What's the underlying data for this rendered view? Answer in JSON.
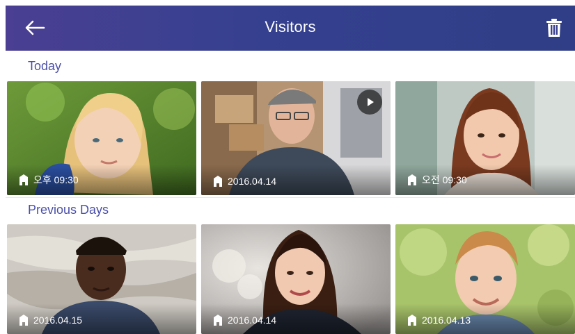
{
  "header": {
    "title": "Visitors",
    "back_icon": "arrow-left-icon",
    "delete_icon": "trash-icon",
    "bg_color": "#3a3f8f"
  },
  "sections": [
    {
      "label": "Today",
      "items": [
        {
          "date": "오후 09:30",
          "icon": "building-icon",
          "has_video": false
        },
        {
          "date": "2016.04.14",
          "icon": "building-icon",
          "has_video": true
        },
        {
          "date": "오전 09:30",
          "icon": "building-icon",
          "has_video": false
        }
      ]
    },
    {
      "label": "Previous Days",
      "items": [
        {
          "date": "2016.04.15",
          "icon": "building-icon",
          "has_video": false
        },
        {
          "date": "2016.04.14",
          "icon": "building-icon",
          "has_video": false
        },
        {
          "date": "2016.04.13",
          "icon": "building-icon",
          "has_video": false
        }
      ]
    }
  ],
  "colors": {
    "section_label": "#4a4fa8",
    "header_gradient_start": "#4a3f92",
    "header_gradient_end": "#2f3e86"
  }
}
